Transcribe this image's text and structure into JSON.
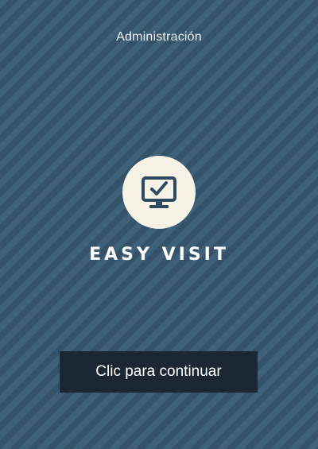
{
  "header": {
    "admin_link": "Administración"
  },
  "logo": {
    "icon": "monitor-check-icon",
    "circle_color": "#f6f3e6",
    "icon_color": "#2e4a60"
  },
  "app": {
    "title": "EASY VISIT"
  },
  "actions": {
    "continue_label": "Clic para continuar"
  }
}
